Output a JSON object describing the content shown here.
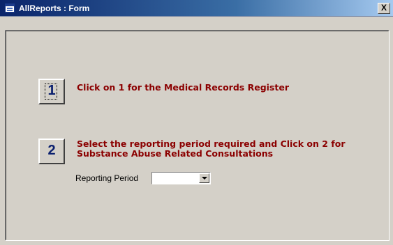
{
  "window": {
    "title": "AllReports : Form",
    "close_label": "X"
  },
  "form": {
    "button1_label": "1",
    "button1_instruction": "Click on 1 for the Medical Records Register",
    "button2_label": "2",
    "button2_instruction_line1": "Select the reporting period required and Click on 2 for",
    "button2_instruction_line2": "Substance Abuse Related Consultations",
    "reporting_period_label": "Reporting Period",
    "reporting_period_value": ""
  },
  "icons": {
    "title_icon": "form-icon",
    "combo_arrow": "chevron-down-icon"
  },
  "colors": {
    "titlebar": "#0a246a",
    "instruction_text": "#8b0000",
    "button_number": "#0a1f6e",
    "face": "#d4d0c8"
  }
}
